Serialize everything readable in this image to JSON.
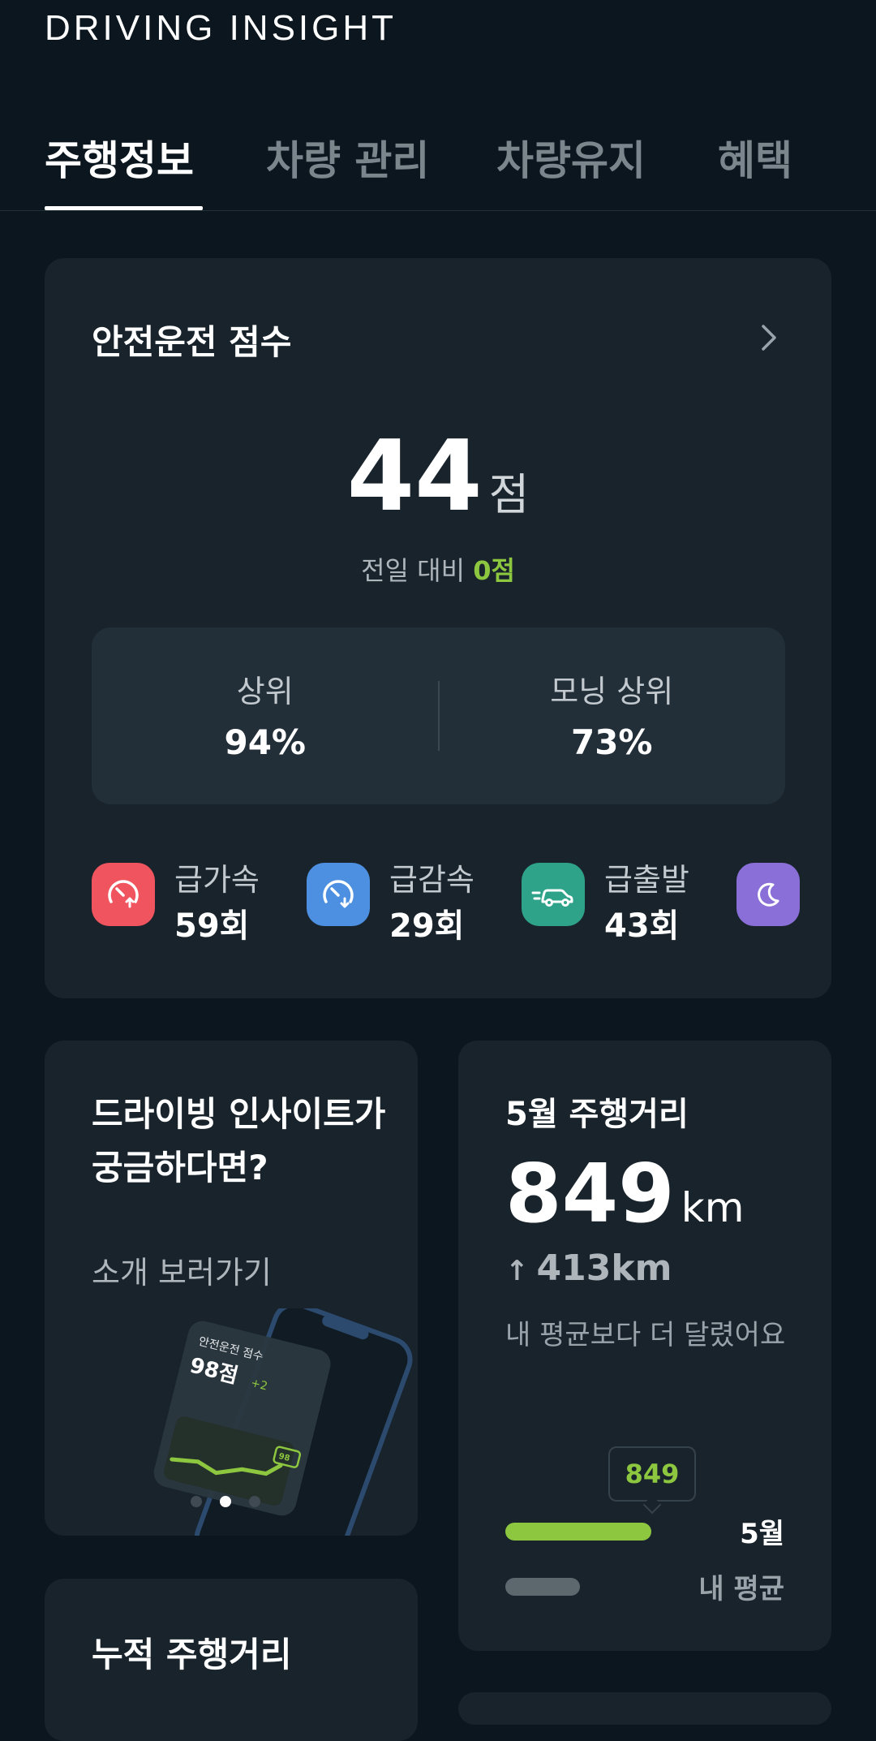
{
  "app": {
    "title": "DRIVING INSIGHT"
  },
  "tabs": [
    {
      "label": "주행정보",
      "active": true
    },
    {
      "label": "차량 관리",
      "active": false
    },
    {
      "label": "차량유지",
      "active": false
    },
    {
      "label": "혜택",
      "active": false
    }
  ],
  "score": {
    "title": "안전운전 점수",
    "value": "44",
    "unit": "점",
    "compare_label": "전일 대비",
    "compare_value": "0점",
    "ranks": [
      {
        "label": "상위",
        "value": "94%"
      },
      {
        "label": "모닝 상위",
        "value": "73%"
      }
    ],
    "events": [
      {
        "label": "급가속",
        "count": "59회",
        "icon": "rapid-acceleration-icon",
        "color": "#f0545e"
      },
      {
        "label": "급감속",
        "count": "29회",
        "icon": "rapid-deceleration-icon",
        "color": "#4d8fe0"
      },
      {
        "label": "급출발",
        "count": "43회",
        "icon": "rapid-start-icon",
        "color": "#2ea389"
      },
      {
        "label": "",
        "count": "",
        "icon": "night-driving-icon",
        "color": "#8a6fd8"
      }
    ]
  },
  "promo": {
    "title": "드라이빙 인사이트가 궁금하다면?",
    "link": "소개 보러가기",
    "art_score_label": "안전운전 점수",
    "art_score_value": "98점",
    "art_score_delta": "+2",
    "art_bubble": "98",
    "carousel_active_index": 1,
    "carousel_count": 3
  },
  "distance": {
    "title": "5월 주행거리",
    "value": "849",
    "unit": "km",
    "delta": "413km",
    "description": "내 평균보다 더 달렸어요",
    "bubble_value": "849",
    "bars": [
      {
        "label": "5월",
        "value": 849,
        "color": "#8dc63f"
      },
      {
        "label": "내 평균",
        "value": 436,
        "color": "#5d676e"
      }
    ]
  },
  "cumulative": {
    "title": "누적 주행거리"
  }
}
